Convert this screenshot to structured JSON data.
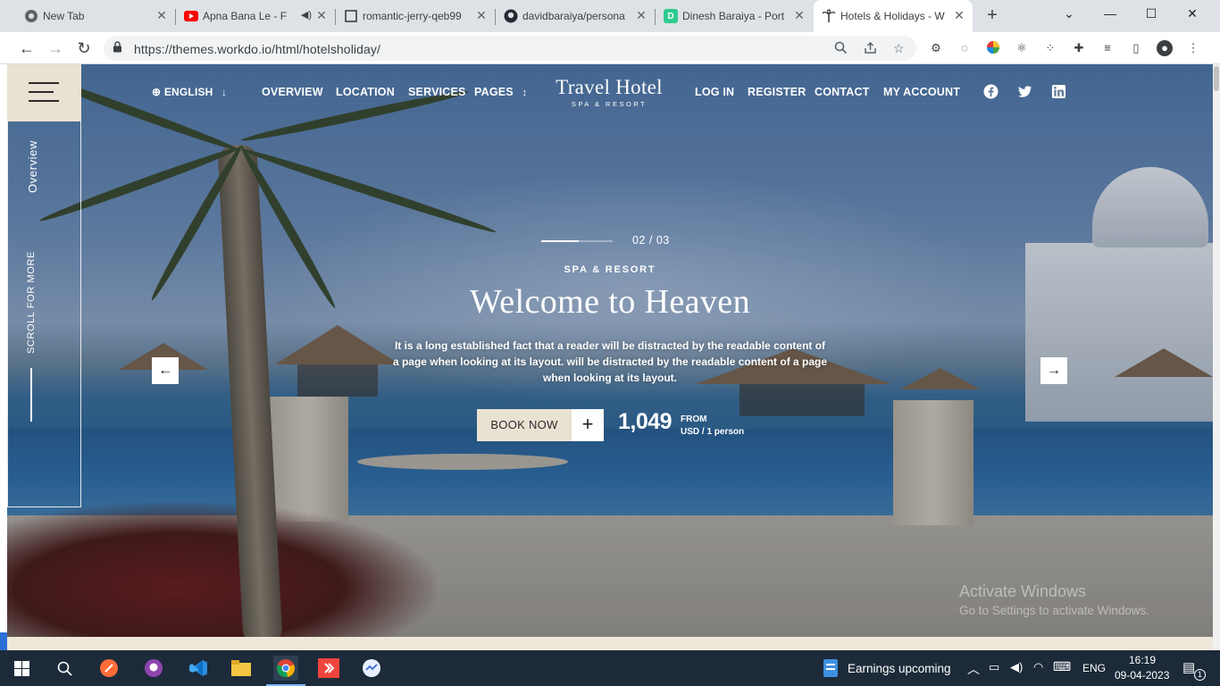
{
  "browser": {
    "tabs": [
      {
        "title": "New Tab",
        "icon": "chrome-icon"
      },
      {
        "title": "Apna Bana Le - F",
        "icon": "youtube-icon"
      },
      {
        "title": "romantic-jerry-qeb99",
        "icon": "square-icon"
      },
      {
        "title": "davidbaraiya/persona",
        "icon": "github-icon"
      },
      {
        "title": "Dinesh Baraiya - Port",
        "icon": "d-logo-icon"
      },
      {
        "title": "Hotels & Holidays - W",
        "icon": "palm-icon",
        "active": true
      }
    ],
    "new_tab_label": "+",
    "url": "https://themes.workdo.io/html/hotelsholiday/",
    "window_controls": [
      "⌄",
      "—",
      "☐",
      "✕"
    ]
  },
  "site": {
    "language": "ENGLISH",
    "nav_left": [
      "OVERVIEW",
      "LOCATION",
      "SERVICES",
      "PAGES"
    ],
    "brand_name": "Travel Hotel",
    "brand_sub": "SPA & RESORT",
    "nav_right": [
      "LOG IN",
      "REGISTER",
      "CONTACT",
      "MY ACCOUNT"
    ],
    "social": [
      "facebook-icon",
      "twitter-icon",
      "linkedin-icon"
    ],
    "side_overview": "Overview",
    "side_scroll": "SCROLL FOR MORE"
  },
  "hero": {
    "slide_counter": "02 / 03",
    "slide_progress": 0.52,
    "eyebrow": "SPA & RESORT",
    "title": "Welcome to Heaven",
    "description": "It is a long established fact that a reader will be distracted by the readable content of a page when looking at its layout. will be distracted by the readable content of a page when looking at its layout.",
    "book_label": "BOOK NOW",
    "plus_label": "+",
    "price": "1,049",
    "price_from": "FROM",
    "price_unit": "USD / 1 person",
    "prev_arrow": "←",
    "next_arrow": "→"
  },
  "watermark": {
    "line1": "Activate Windows",
    "line2": "Go to Settings to activate Windows."
  },
  "taskbar": {
    "news": "Earnings upcoming",
    "language": "ENG",
    "time": "16:19",
    "date": "09-04-2023",
    "notification_count": "1"
  },
  "colors": {
    "cream": "#e9e1d2",
    "taskbar": "#1c2a3a"
  }
}
